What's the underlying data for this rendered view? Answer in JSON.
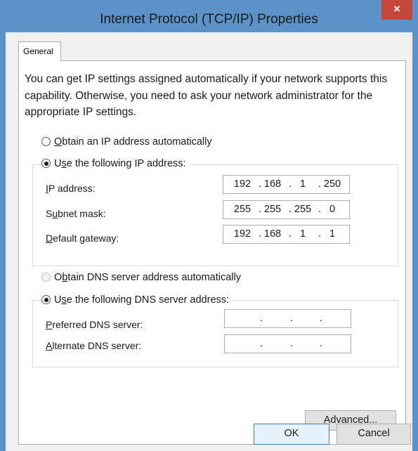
{
  "window": {
    "title": "Internet Protocol (TCP/IP) Properties",
    "close_glyph": "×"
  },
  "tabs": [
    {
      "label": "General",
      "selected": true
    }
  ],
  "description": "You can get IP settings assigned automatically if your network supports this capability. Otherwise, you need to ask your network administrator for the appropriate IP settings.",
  "ip_section": {
    "auto_option": {
      "label_pre": "",
      "label_accel": "O",
      "label_post": "btain an IP address automatically",
      "checked": false
    },
    "manual_option": {
      "label_pre": "U",
      "label_accel": "s",
      "label_post": "e the following IP address:",
      "checked": true
    },
    "fields": {
      "ip_address": {
        "label_accel": "I",
        "label_post": "P address:",
        "segments": [
          "192",
          "168",
          "1",
          "250"
        ]
      },
      "subnet_mask": {
        "label_pre": "S",
        "label_accel": "u",
        "label_post": "bnet mask:",
        "segments": [
          "255",
          "255",
          "255",
          "0"
        ]
      },
      "default_gateway": {
        "label_accel": "D",
        "label_post": "efault gateway:",
        "segments": [
          "192",
          "168",
          "1",
          "1"
        ]
      }
    }
  },
  "dns_section": {
    "auto_option": {
      "label_pre": "O",
      "label_accel": "b",
      "label_post": "tain DNS server address automatically",
      "checked": false,
      "enabled": false
    },
    "manual_option": {
      "label_pre": "U",
      "label_accel": "s",
      "label_post": "e the following DNS server address:",
      "checked": true
    },
    "fields": {
      "preferred": {
        "label_accel": "P",
        "label_post": "referred DNS server:",
        "segments": [
          "",
          "",
          "",
          ""
        ]
      },
      "alternate": {
        "label_accel": "A",
        "label_post": "lternate DNS server:",
        "segments": [
          "",
          "",
          "",
          ""
        ]
      }
    }
  },
  "buttons": {
    "advanced": {
      "label_pre": "Ad",
      "label_accel": "v",
      "label_post": "anced..."
    },
    "ok": {
      "label": "OK"
    },
    "cancel": {
      "label": "Cancel"
    }
  },
  "colors": {
    "titlebar": "#5b93c9",
    "close_button": "#c7463a",
    "dialog_bg": "#f0f0f0"
  }
}
